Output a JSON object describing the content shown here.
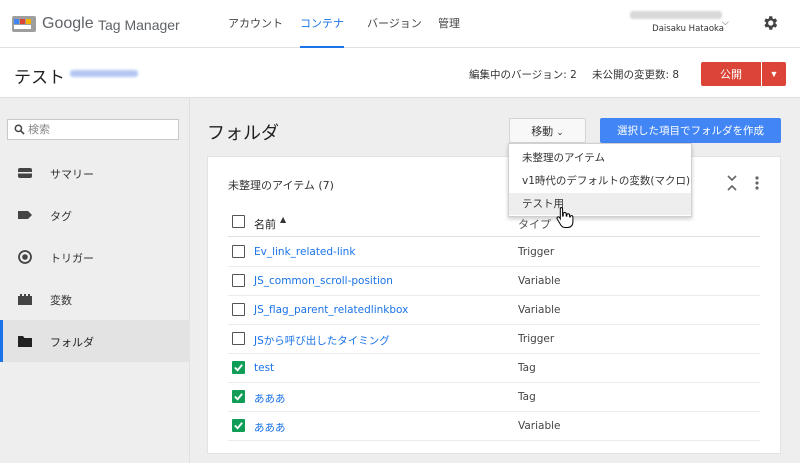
{
  "header": {
    "brand_google": "Google",
    "brand_product": "Tag Manager",
    "nav": [
      "アカウント",
      "コンテナ",
      "バージョン",
      "管理"
    ],
    "active_nav": "コンテナ",
    "account_name": "Daisaku Hataoka"
  },
  "container": {
    "name": "テスト",
    "editing_version": "編集中のバージョン: 2",
    "unpublished_changes": "未公開の変更数: 8",
    "publish_label": "公開"
  },
  "sidebar": {
    "search_placeholder": "検索",
    "items": [
      {
        "label": "サマリー",
        "icon": "summary-icon"
      },
      {
        "label": "タグ",
        "icon": "tag-icon"
      },
      {
        "label": "トリガー",
        "icon": "trigger-icon"
      },
      {
        "label": "変数",
        "icon": "variable-icon"
      },
      {
        "label": "フォルダ",
        "icon": "folder-icon"
      }
    ],
    "active_item": "フォルダ"
  },
  "main": {
    "title": "フォルダ",
    "move_label": "移動",
    "create_folder_label": "選択した項目でフォルダを作成",
    "card_title": "未整理のアイテム (7)",
    "col_name": "名前",
    "col_type": "タイプ",
    "rows": [
      {
        "name": "Ev_link_related-link",
        "type": "Trigger",
        "checked": false
      },
      {
        "name": "JS_common_scroll-position",
        "type": "Variable",
        "checked": false
      },
      {
        "name": "JS_flag_parent_relatedlinkbox",
        "type": "Variable",
        "checked": false
      },
      {
        "name": "JSから呼び出したタイミング",
        "type": "Trigger",
        "checked": false
      },
      {
        "name": "test",
        "type": "Tag",
        "checked": true
      },
      {
        "name": "あああ",
        "type": "Tag",
        "checked": true
      },
      {
        "name": "あああ",
        "type": "Variable",
        "checked": true
      }
    ]
  },
  "move_menu": {
    "items": [
      "未整理のアイテム",
      "v1時代のデフォルトの変数(マクロ)",
      "テスト用"
    ],
    "hovered": "テスト用"
  },
  "colors": {
    "accent": "#1a73e8",
    "publish": "#db4437",
    "create_button": "#4285f4",
    "checkbox_checked": "#0f9d58"
  }
}
